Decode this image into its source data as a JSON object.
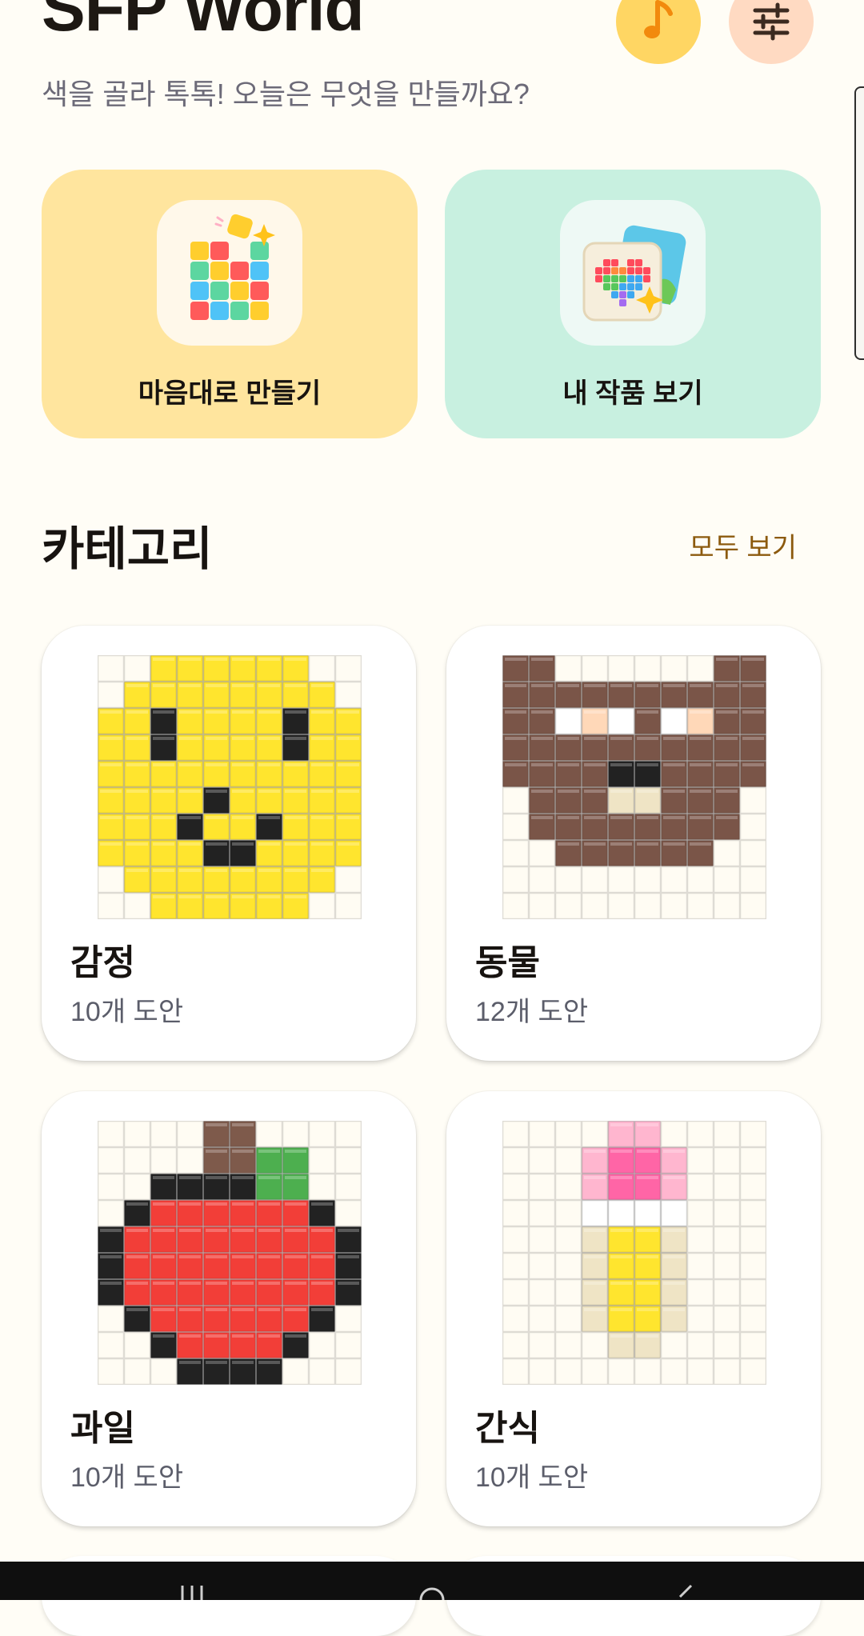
{
  "header": {
    "title": "SFP World",
    "subtitle": "색을 골라 톡톡! 오늘은 무엇을 만들까요?",
    "music_icon": "music-note-icon",
    "settings_icon": "sliders-icon",
    "colors": {
      "music_bg": "#FFD663",
      "settings_bg": "#FFDAC2"
    }
  },
  "quick_actions": [
    {
      "label": "마음대로 만들기",
      "icon": "color-blocks-icon",
      "color": "#FFE59E"
    },
    {
      "label": "내 작품 보기",
      "icon": "gallery-icon",
      "color": "#C8F0E0"
    }
  ],
  "categories_section": {
    "title": "카테고리",
    "see_all": "모두 보기",
    "items": [
      {
        "name": "감정",
        "count": "10개 도안",
        "pattern": "smiley-face"
      },
      {
        "name": "동물",
        "count": "12개 도안",
        "pattern": "bear-face"
      },
      {
        "name": "과일",
        "count": "10개 도안",
        "pattern": "apple"
      },
      {
        "name": "간식",
        "count": "10개 도안",
        "pattern": "popsicle"
      }
    ]
  },
  "pixel_art": {
    "palette": {
      ".": "#FFFCF3",
      "y": "#FFE52E",
      "k": "#222222",
      "b": "#7A5548",
      "p": "#FFD8B8",
      "w": "#FFFFFF",
      "e": "#EFE4C5",
      "r": "#F23E38",
      "g": "#4DAF4F",
      "n": "#7E5A4B",
      "m": "#FFB6CF",
      "h": "#FF65A6"
    },
    "patterns": {
      "smiley-face": [
        "..yyyyyy..",
        ".yyyyyyyy.",
        "yykyyyykyy",
        "yykyyyykyy",
        "yyyyyyyyyy",
        "yyyykyyyyy",
        "yyykyykyyy",
        "yyyykkyyyy",
        ".yyyyyyyy.",
        "..yyyyyy.."
      ],
      "bear-face": [
        "bb......bb",
        "bbbbbbbbbb",
        "bbwpwbwpbb",
        "bbbbbbbbbb",
        "bbbbkkbbbb",
        ".bbbeebbb.",
        ".bbbbbbbb.",
        "..bbbbbb..",
        "..........",
        ".........."
      ],
      "apple": [
        "....nn....",
        "....nngg..",
        "..kkkkgg..",
        ".krrrrrrk.",
        "krrrrrrrrk",
        "krrrrrrrrk",
        "krrrrrrrrk",
        ".krrrrrrk.",
        "..krrrrk..",
        "...kkkk..."
      ],
      "popsicle": [
        "....mm....",
        "...mhhm...",
        "...mhhm...",
        "...wwww...",
        "...eyye...",
        "...eyye...",
        "...eyye...",
        "...eyye...",
        "....ee....",
        ".........."
      ]
    }
  },
  "system_nav": {
    "recent_icon": "recent-apps-icon",
    "home_icon": "home-icon",
    "back_icon": "back-icon"
  }
}
